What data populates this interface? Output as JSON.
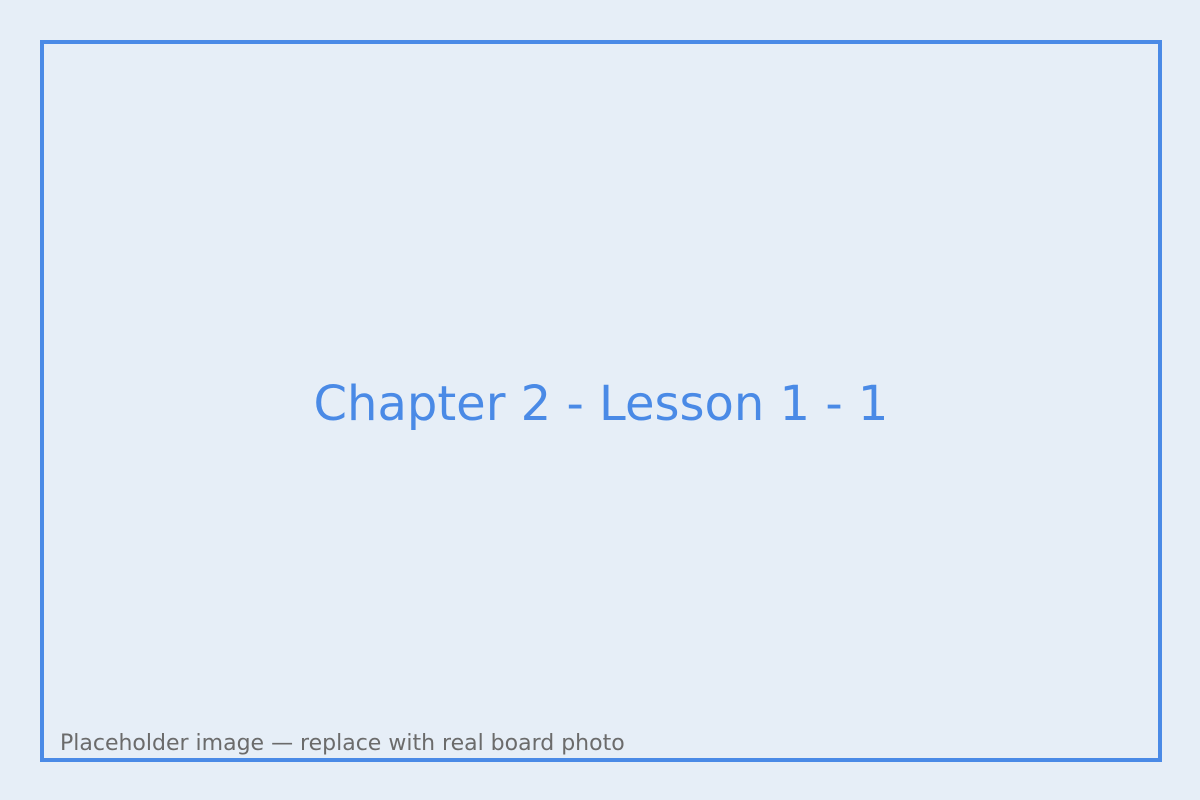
{
  "placeholder": {
    "title": "Chapter 2 - Lesson 1 - 1",
    "caption": "Placeholder image — replace with real board photo"
  },
  "colors": {
    "background": "#e6eef7",
    "accent": "#4a8ae6",
    "caption_text": "#6b6b6b"
  }
}
